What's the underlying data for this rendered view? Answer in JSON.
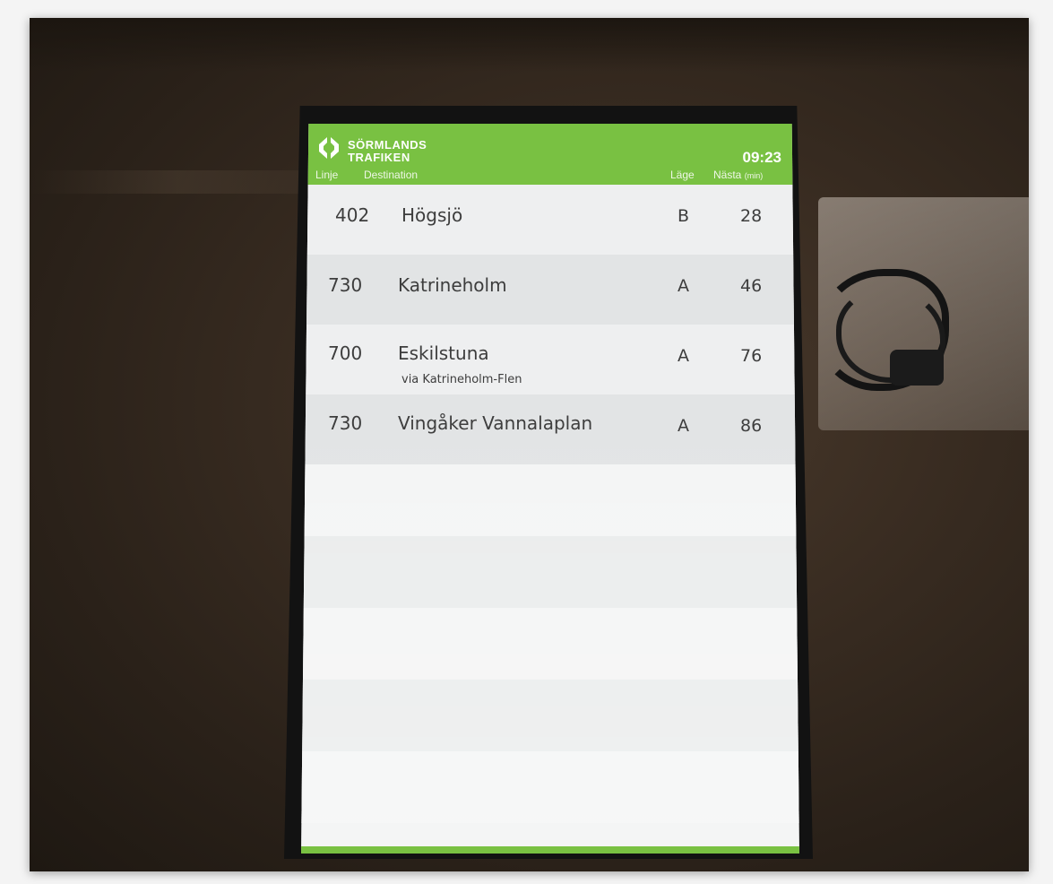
{
  "display": {
    "brand_line_1": "SÖRMLANDS",
    "brand_line_2": "TRAFIKEN",
    "clock": "09:23",
    "accent_color": "#79c142",
    "logo_icon": "sormlandstrafiken-logo-icon"
  },
  "columns": {
    "line": "Linje",
    "destination": "Destination",
    "position": "Läge",
    "next": "Nästa",
    "next_unit": "(min)"
  },
  "departures": [
    {
      "line": "402",
      "destination": "Högsjö",
      "via": "",
      "position": "B",
      "next": "28"
    },
    {
      "line": "730",
      "destination": "Katrineholm",
      "via": "",
      "position": "A",
      "next": "46"
    },
    {
      "line": "700",
      "destination": "Eskilstuna",
      "via": "via Katrineholm-Flen",
      "position": "A",
      "next": "76"
    },
    {
      "line": "730",
      "destination": "Vingåker Vannalaplan",
      "via": "",
      "position": "A",
      "next": "86"
    }
  ]
}
